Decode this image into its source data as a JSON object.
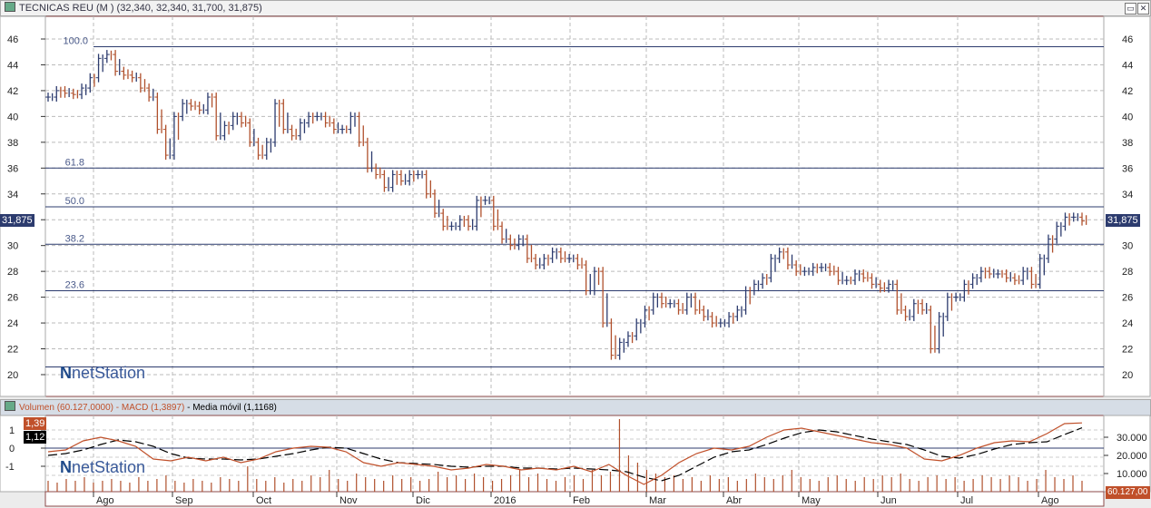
{
  "window": {
    "title": "TECNICAS REU (M ) (32,340, 32,340, 31,700, 31,875)",
    "restore": "▭",
    "close": "✕"
  },
  "lower_panel": {
    "volume_label": "Volumen (60.127,0000)",
    "macd_label": "MACD (1,3897)",
    "ma_label": "Media móvil (1,1168)",
    "macd_tag": "1,39",
    "signal_tag": "1,12",
    "volume_tag": "60.127,00"
  },
  "price_tag": "31,875",
  "watermark": "netStation",
  "colors": {
    "up": "#2c3b6e",
    "down": "#b0502c",
    "fib": "#2c3b6e",
    "macd": "#c0502a",
    "signal": "#000000"
  },
  "chart_data": [
    {
      "type": "ohlc",
      "title": "TECNICAS REU (M )",
      "ylim": [
        19,
        47
      ],
      "yticks": [
        20,
        22,
        24,
        26,
        28,
        30,
        32,
        34,
        36,
        38,
        40,
        42,
        44,
        46
      ],
      "xticks": [
        "Ago",
        "Sep",
        "Oct",
        "Nov",
        "Dic",
        "2016",
        "Feb",
        "Mar",
        "Abr",
        "May",
        "Jun",
        "Jul",
        "Ago"
      ],
      "last": 31.875,
      "fibonacci": [
        {
          "label": "100.0",
          "value": 45.4
        },
        {
          "label": "61.8",
          "value": 36.0
        },
        {
          "label": "50.0",
          "value": 33.0
        },
        {
          "label": "38.2",
          "value": 30.1
        },
        {
          "label": "23.6",
          "value": 26.5
        },
        {
          "label": "",
          "value": 20.6
        }
      ],
      "closes": [
        41.5,
        42,
        41.8,
        41.7,
        42.2,
        43,
        44.5,
        44.8,
        43.5,
        43.2,
        43,
        42.2,
        41.5,
        39,
        37,
        40,
        41,
        40.8,
        40.5,
        41.5,
        38.5,
        39.3,
        40,
        39.5,
        38,
        37,
        38,
        41,
        39,
        38.5,
        39.5,
        40,
        40,
        39.5,
        39,
        39,
        40,
        38,
        36,
        35.5,
        34.5,
        35.5,
        35,
        35.5,
        35.5,
        34,
        32.5,
        31.5,
        31.5,
        32,
        31.5,
        33.5,
        33.5,
        31.5,
        30.5,
        30,
        30.5,
        29,
        28.5,
        29,
        29.5,
        29,
        29,
        28.5,
        26.5,
        28,
        24,
        21.5,
        22.5,
        23,
        24,
        25,
        26,
        25.5,
        25.5,
        25,
        26,
        25,
        24.5,
        24,
        24,
        24.5,
        25,
        26.5,
        27,
        27.5,
        29,
        29.5,
        28.5,
        28,
        28,
        28.3,
        28.3,
        28,
        27.3,
        27.3,
        27.8,
        27.5,
        27,
        26.7,
        27,
        25,
        24.5,
        25.5,
        25,
        22,
        24.5,
        26,
        26,
        27,
        27.5,
        28,
        27.8,
        27.8,
        27.5,
        27.3,
        28,
        27,
        29,
        30.5,
        31.5,
        32.2,
        32.2,
        31.9
      ]
    },
    {
      "type": "line",
      "title": "MACD",
      "ylim": [
        -2.4,
        1.8
      ],
      "yticks": [
        1,
        0,
        -1
      ],
      "macd": [
        -0.2,
        -0.1,
        0.4,
        0.6,
        0.4,
        0.1,
        -0.6,
        -0.7,
        -0.5,
        -0.7,
        -0.5,
        -0.8,
        -0.6,
        -0.2,
        0,
        0.1,
        0.05,
        -0.2,
        -0.8,
        -1.0,
        -0.8,
        -0.9,
        -1.0,
        -1.2,
        -1.1,
        -0.9,
        -1.0,
        -1.2,
        -1.1,
        -1.2,
        -1.0,
        -1.3,
        -0.9,
        -1.5,
        -2.0,
        -1.5,
        -0.8,
        -0.3,
        0,
        -0.1,
        0.1,
        0.6,
        1.0,
        1.1,
        0.9,
        0.7,
        0.5,
        0.3,
        0.2,
        0.0,
        -0.6,
        -0.7,
        -0.4,
        0,
        0.3,
        0.4,
        0.35,
        0.8,
        1.35,
        1.39
      ],
      "signal": [
        -0.4,
        -0.3,
        -0.1,
        0.2,
        0.45,
        0.35,
        0.1,
        -0.3,
        -0.55,
        -0.6,
        -0.6,
        -0.65,
        -0.6,
        -0.45,
        -0.3,
        -0.1,
        0.05,
        0,
        -0.3,
        -0.6,
        -0.8,
        -0.85,
        -0.9,
        -1.0,
        -1.05,
        -1.0,
        -1.0,
        -1.1,
        -1.1,
        -1.15,
        -1.1,
        -1.15,
        -1.2,
        -1.3,
        -1.6,
        -1.8,
        -1.5,
        -1.0,
        -0.5,
        -0.2,
        -0.1,
        0.2,
        0.55,
        0.85,
        1.0,
        0.9,
        0.7,
        0.5,
        0.35,
        0.2,
        -0.1,
        -0.45,
        -0.55,
        -0.35,
        -0.05,
        0.2,
        0.3,
        0.35,
        0.75,
        1.12
      ],
      "volume_yticks": [
        "30.000",
        "20.000",
        "10.000"
      ],
      "volume": [
        6,
        5,
        7,
        6,
        8,
        5,
        6,
        7,
        6,
        5,
        8,
        6,
        7,
        9,
        6,
        5,
        7,
        6,
        5,
        8,
        7,
        6,
        14,
        7,
        6,
        8,
        5,
        7,
        6,
        9,
        8,
        12,
        7,
        6,
        10,
        8,
        7,
        6,
        9,
        7,
        8,
        6,
        7,
        11,
        8,
        9,
        7,
        10,
        8,
        6,
        7,
        9,
        12,
        8,
        10,
        7,
        6,
        8,
        9,
        7,
        12,
        9,
        11,
        45,
        20,
        16,
        12,
        10,
        8,
        9,
        7,
        8,
        6,
        9,
        7,
        8,
        6,
        7,
        10,
        8,
        7,
        9,
        12,
        8,
        7,
        6,
        8,
        9,
        7,
        6,
        8,
        7,
        9,
        8,
        10,
        7,
        6,
        8,
        9,
        7,
        8,
        6,
        7,
        9,
        8,
        7,
        9,
        8,
        6,
        7,
        12,
        8,
        7,
        9,
        6
      ]
    }
  ]
}
